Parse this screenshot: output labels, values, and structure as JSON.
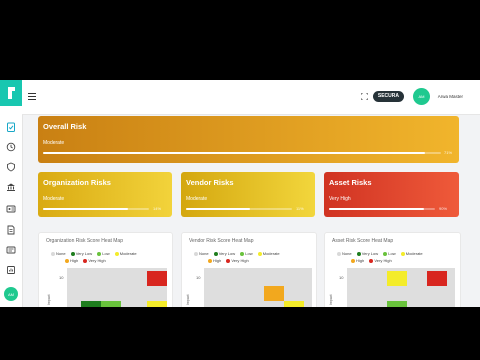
{
  "header": {
    "org_badge": "SECURA",
    "user_initials": "AM",
    "user_name": "Arwa Master"
  },
  "sidebar": {
    "items": [
      {
        "icon": "clipboard-check-icon",
        "active": true
      },
      {
        "icon": "history-icon"
      },
      {
        "icon": "shield-icon"
      },
      {
        "icon": "bank-icon"
      },
      {
        "icon": "id-card-icon"
      },
      {
        "icon": "document-icon"
      },
      {
        "icon": "contact-card-icon"
      },
      {
        "icon": "report-icon"
      }
    ],
    "avatar": "AM"
  },
  "overall": {
    "title": "Overall Risk",
    "level": "Moderate",
    "progress": 0.96,
    "pct": "71%"
  },
  "cards": [
    {
      "title": "Organization Risks",
      "level": "Moderate",
      "progress": 0.8,
      "pct": "14%"
    },
    {
      "title": "Vendor Risks",
      "level": "Moderate",
      "progress": 0.6,
      "pct": "11%"
    },
    {
      "title": "Asset Risks",
      "level": "Very High",
      "progress": 0.9,
      "pct": "90%"
    }
  ],
  "heatmaps": [
    {
      "title": "Organization Risk Score Heat Map",
      "ytick": "10"
    },
    {
      "title": "Vendor Risk Score Heat Map",
      "ytick": "10"
    },
    {
      "title": "Asset Risk Score Heat Map",
      "ytick": "10"
    }
  ],
  "legend": {
    "none": "None",
    "very_low": "Very Low",
    "low": "Low",
    "moderate": "Moderate",
    "high": "High",
    "very_high": "Very High"
  },
  "colors": {
    "none": "#d9d9d9",
    "very_low": "#1e7d1e",
    "low": "#69c23c",
    "moderate": "#f4ec2a",
    "high": "#f2a81e",
    "very_high": "#d8261f",
    "accent": "#18c7b0"
  },
  "axis_label": "Impact"
}
